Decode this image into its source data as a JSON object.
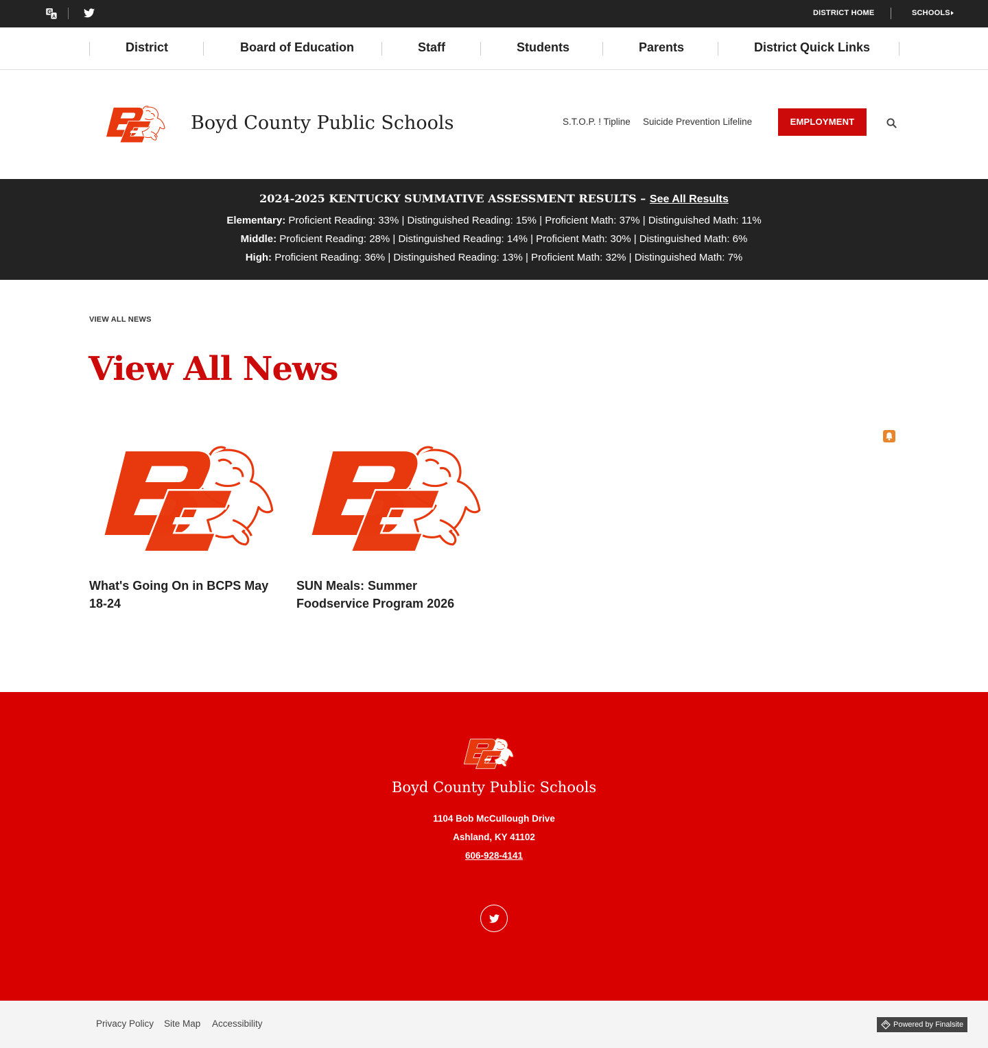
{
  "topbar": {
    "translate_icon": "translate-icon",
    "twitter_icon": "twitter-icon",
    "district_home": "DISTRICT HOME",
    "schools": "SCHOOLS"
  },
  "nav": {
    "items": [
      {
        "label": "District"
      },
      {
        "label": "Board of Education"
      },
      {
        "label": "Staff"
      },
      {
        "label": "Students"
      },
      {
        "label": "Parents"
      },
      {
        "label": "District Quick Links"
      }
    ]
  },
  "header": {
    "site_title": "Boyd County Public Schools",
    "links": [
      "S.T.O.P. ! Tipline",
      "Suicide Prevention Lifeline"
    ],
    "employment": "EMPLOYMENT",
    "search_icon": "search-icon"
  },
  "banner": {
    "title": "2024-2025 KENTUCKY SUMMATIVE ASSESSMENT RESULTS –",
    "link": "See All Results",
    "rows": [
      {
        "label": "Elementary:",
        "text": "Proficient Reading: 33% | Distinguished Reading: 15% | Proficient Math: 37% | Distinguished Math: 11%"
      },
      {
        "label": "Middle:",
        "text": "Proficient Reading: 28% | Distinguished Reading: 14% | Proficient Math: 30% | Distinguished Math: 6%"
      },
      {
        "label": "High:",
        "text": "Proficient Reading: 36% | Distinguished Reading: 13% | Proficient Math: 32% | Distinguished Math: 7%"
      }
    ]
  },
  "content": {
    "breadcrumb": "VIEW ALL NEWS",
    "title": "View All News",
    "rss_icon": "rss-icon",
    "news": [
      {
        "title": "What's Going On in BCPS May 18-24"
      },
      {
        "title": "SUN Meals: Summer Foodservice Program 2026"
      }
    ]
  },
  "footer": {
    "name": "Boyd County Public Schools",
    "address1": "1104 Bob McCullough Drive",
    "address2": "Ashland, KY  41102",
    "phone": "606-928-4141"
  },
  "bottom": {
    "links": [
      "Privacy Policy",
      "Site Map",
      "Accessibility"
    ],
    "powered": "Powered by Finalsite"
  },
  "colors": {
    "brand_red": "#cc0a0a",
    "footer_red": "#d90000",
    "dark": "#232323",
    "logo_orange": "#e8380d"
  }
}
